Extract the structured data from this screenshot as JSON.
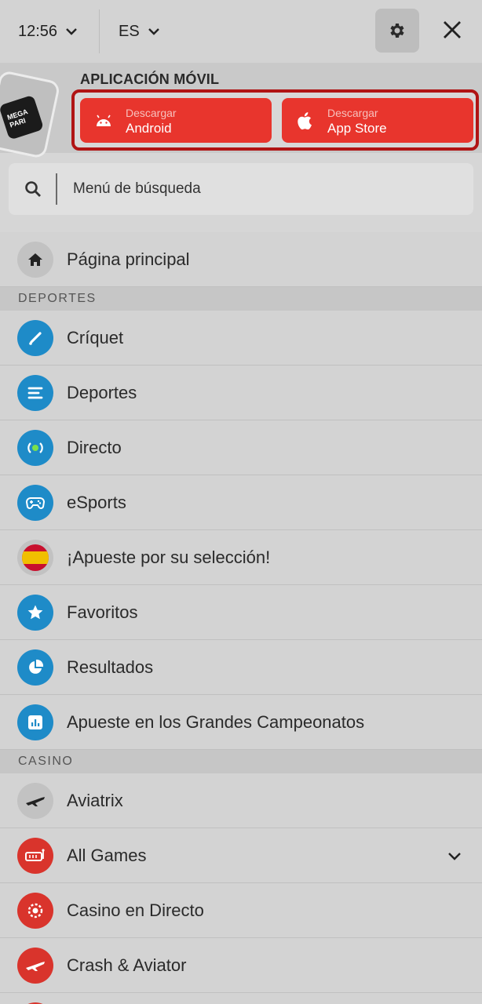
{
  "header": {
    "time": "12:56",
    "language": "ES"
  },
  "promo": {
    "title": "APLICACIÓN MÓVIL",
    "logo_text_1": "MEGA",
    "logo_text_2": "PARI",
    "android": {
      "small": "Descargar",
      "big": "Android"
    },
    "apple": {
      "small": "Descargar",
      "big": "App Store"
    }
  },
  "search": {
    "placeholder": "Menú de búsqueda"
  },
  "menu": {
    "home": "Página principal",
    "section_sports": "DEPORTES",
    "sports": [
      {
        "label": "Críquet",
        "icon": "cricket-icon",
        "color": "#1e8bc8"
      },
      {
        "label": "Deportes",
        "icon": "list-icon",
        "color": "#1e8bc8"
      },
      {
        "label": "Directo",
        "icon": "live-icon",
        "color": "#1e8bc8"
      },
      {
        "label": "eSports",
        "icon": "gamepad-icon",
        "color": "#1e8bc8"
      },
      {
        "label": "¡Apueste por su selección!",
        "icon": "spain-flag-icon",
        "color": "#c2c2c2"
      },
      {
        "label": "Favoritos",
        "icon": "star-icon",
        "color": "#1e8bc8"
      },
      {
        "label": "Resultados",
        "icon": "pie-chart-icon",
        "color": "#1e8bc8"
      },
      {
        "label": "Apueste en los Grandes Campeonatos",
        "icon": "bar-chart-icon",
        "color": "#1e8bc8"
      }
    ],
    "section_casino": "CASINO",
    "casino": [
      {
        "label": "Aviatrix",
        "icon": "plane-icon",
        "color": "#c2c2c2"
      },
      {
        "label": "All Games",
        "icon": "slot-icon",
        "color": "#d9342c"
      },
      {
        "label": "Casino en Directo",
        "icon": "chip-icon",
        "color": "#d9342c"
      },
      {
        "label": "Crash & Aviator",
        "icon": "crash-plane-icon",
        "color": "#d9342c"
      }
    ]
  }
}
